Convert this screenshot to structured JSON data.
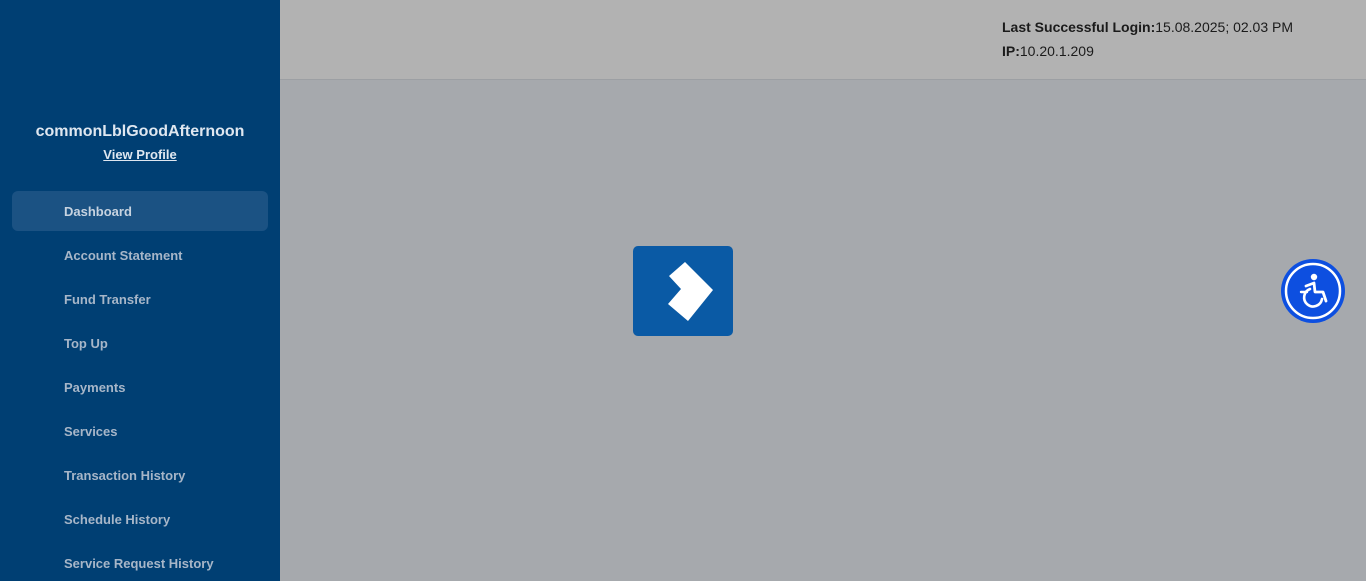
{
  "sidebar": {
    "greeting": "commonLblGoodAfternoon",
    "view_profile": "View Profile",
    "items": [
      {
        "label": "Dashboard"
      },
      {
        "label": "Account Statement"
      },
      {
        "label": "Fund Transfer"
      },
      {
        "label": "Top Up"
      },
      {
        "label": "Payments"
      },
      {
        "label": "Services"
      },
      {
        "label": "Transaction History"
      },
      {
        "label": "Schedule History"
      },
      {
        "label": "Service Request History"
      }
    ]
  },
  "header": {
    "last_login_label": "Last Successful Login:",
    "last_login_value": "15.08.2025; 02.03 PM",
    "ip_label": "IP:",
    "ip_value": "10.20.1.209"
  },
  "colors": {
    "sidebar": "#003f73",
    "active_item": "#1b5283",
    "overlay": "#a6a9ad",
    "loader": "#0a5aa5",
    "accessibility": "#0d4fe0"
  },
  "icons": {
    "loader": "chevron-right-icon",
    "accessibility": "accessibility-icon"
  }
}
